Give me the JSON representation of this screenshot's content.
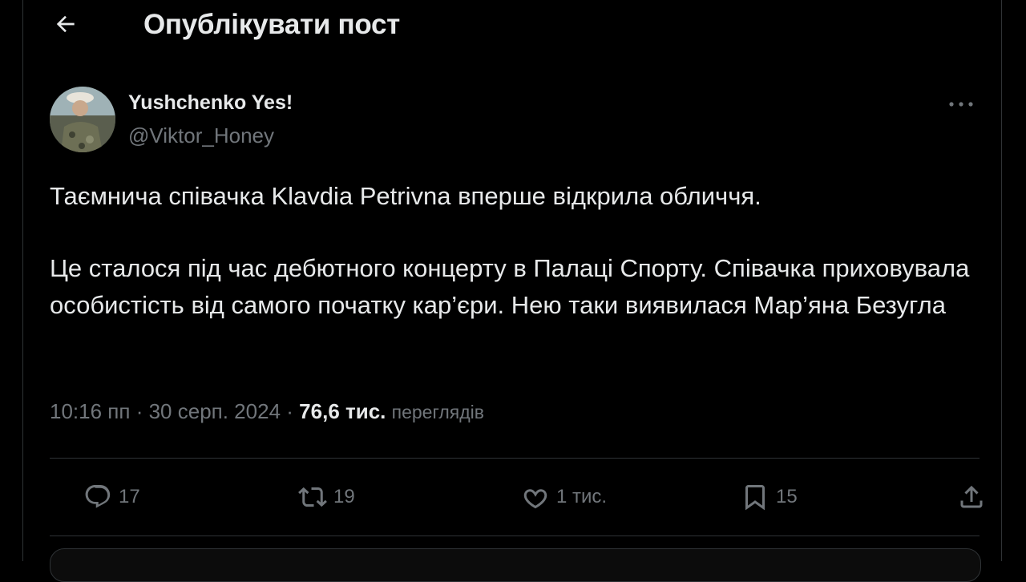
{
  "header": {
    "back_icon": "arrow-left-icon",
    "title": "Опублікувати пост"
  },
  "post": {
    "author": {
      "display_name": "Yushchenko Yes!",
      "handle": "@Viktor_Honey"
    },
    "more_icon": "more-horizontal-icon",
    "paragraphs": [
      "Таємнича співачка Klavdia Petrivna вперше відкрила обличчя.",
      "Це сталося під час дебютного концерту в Палаці Спорту. Співачка приховувала особистість від самого початку кар’єри. Нею таки виявилася Мар’яна Безугла"
    ],
    "time": "10:16 пп",
    "date": "30 серп. 2024",
    "separator": "·",
    "views_count": "76,6 тис.",
    "views_label": "переглядів"
  },
  "actions": {
    "reply": {
      "icon": "reply-icon",
      "count": "17"
    },
    "repost": {
      "icon": "repost-icon",
      "count": "19"
    },
    "like": {
      "icon": "heart-icon",
      "count": "1 тис."
    },
    "bookmark": {
      "icon": "bookmark-icon",
      "count": "15"
    },
    "share": {
      "icon": "share-icon"
    }
  },
  "colors": {
    "background": "#000000",
    "text": "#e7e9ea",
    "muted": "#71767b",
    "border": "#2f3336"
  }
}
